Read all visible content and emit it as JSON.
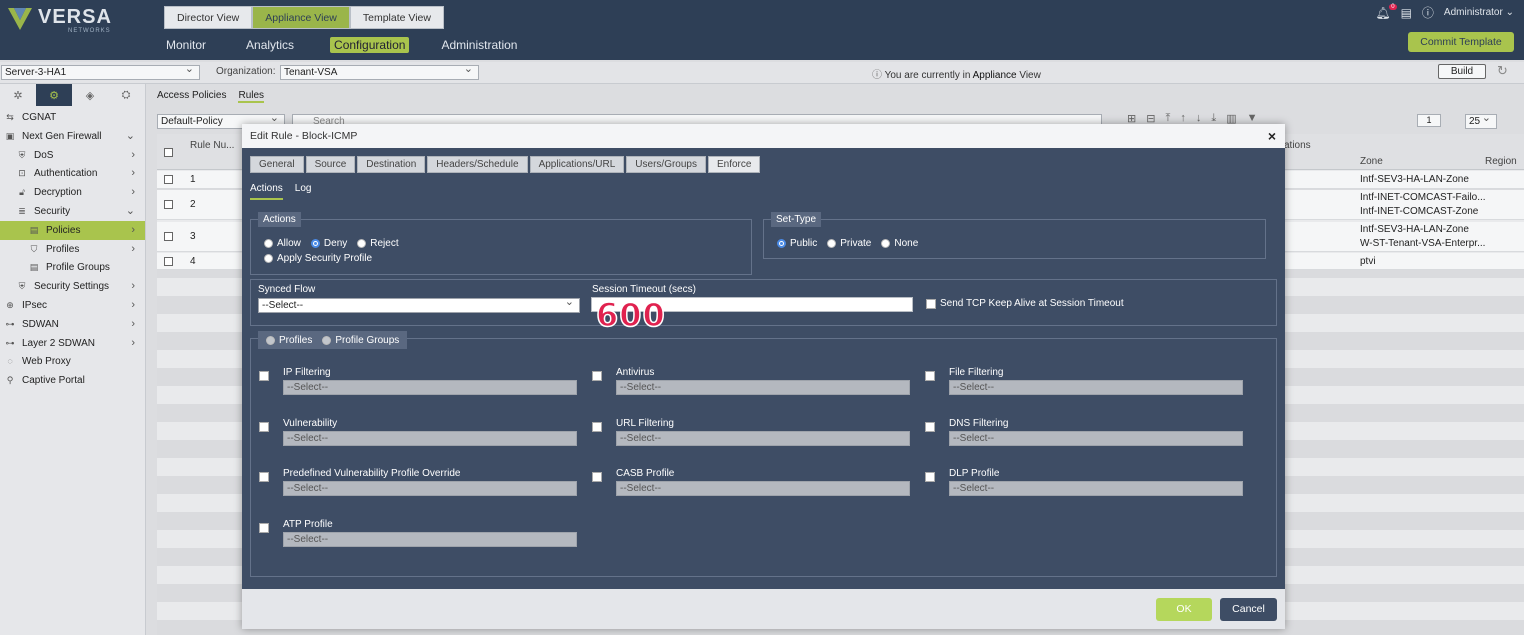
{
  "header": {
    "logo_text": "VERSA",
    "logo_sub": "NETWORKS",
    "view_tabs": [
      {
        "label": "Director View",
        "active": false
      },
      {
        "label": "Appliance View",
        "active": true
      },
      {
        "label": "Template View",
        "active": false
      }
    ],
    "nav": [
      {
        "label": "Monitor",
        "active": false
      },
      {
        "label": "Analytics",
        "active": false
      },
      {
        "label": "Configuration",
        "active": true
      },
      {
        "label": "Administration",
        "active": false
      }
    ],
    "notification_count": "0",
    "user": "Administrator",
    "commit_label": "Commit Template"
  },
  "subbar": {
    "appliance": "Server-3-HA1",
    "org_label": "Organization:",
    "org_value": "Tenant-VSA",
    "info_prefix": "You are currently in ",
    "info_strong": "Appliance",
    "info_suffix": " View",
    "build_label": "Build"
  },
  "sidebar": {
    "items": [
      {
        "label": "CGNAT",
        "icon": "cgnat-icon",
        "indent": 0,
        "chevron": ""
      },
      {
        "label": "Next Gen Firewall",
        "icon": "firewall-icon",
        "indent": 0,
        "chevron": "⌄"
      },
      {
        "label": "DoS",
        "icon": "dos-icon",
        "indent": 1,
        "chevron": "›"
      },
      {
        "label": "Authentication",
        "icon": "authentication-icon",
        "indent": 1,
        "chevron": "›"
      },
      {
        "label": "Decryption",
        "icon": "decryption-icon",
        "indent": 1,
        "chevron": "›"
      },
      {
        "label": "Security",
        "icon": "security-icon",
        "indent": 1,
        "chevron": "⌄"
      },
      {
        "label": "Policies",
        "icon": "policies-icon",
        "indent": 2,
        "chevron": "›",
        "selected": true
      },
      {
        "label": "Profiles",
        "icon": "profiles-icon",
        "indent": 2,
        "chevron": "›"
      },
      {
        "label": "Profile Groups",
        "icon": "profile-groups-icon",
        "indent": 2,
        "chevron": ""
      },
      {
        "label": "Security Settings",
        "icon": "security-settings-icon",
        "indent": 1,
        "chevron": "›"
      },
      {
        "label": "IPsec",
        "icon": "ipsec-icon",
        "indent": 0,
        "chevron": "›"
      },
      {
        "label": "SDWAN",
        "icon": "sdwan-icon",
        "indent": 0,
        "chevron": "›"
      },
      {
        "label": "Layer 2 SDWAN",
        "icon": "layer2-sdwan-icon",
        "indent": 0,
        "chevron": "›"
      },
      {
        "label": "Web Proxy",
        "icon": "web-proxy-icon",
        "indent": 0,
        "chevron": ""
      },
      {
        "label": "Captive Portal",
        "icon": "captive-portal-icon",
        "indent": 0,
        "chevron": ""
      }
    ]
  },
  "content": {
    "breadcrumb": [
      "Access Policies",
      "Rules"
    ],
    "policy": "Default-Policy",
    "search_placeholder": "Search",
    "page": "1",
    "per_page": "25",
    "columns": {
      "rule_num": "Rule Nu...",
      "destinations": "ations",
      "zone": "Zone",
      "region": "Region"
    },
    "rows": [
      {
        "num": "1",
        "zone": [
          "Intf-SEV3-HA-LAN-Zone"
        ]
      },
      {
        "num": "2",
        "zone": [
          "Intf-INET-COMCAST-Failo...",
          "Intf-INET-COMCAST-Zone"
        ]
      },
      {
        "num": "3",
        "zone": [
          "Intf-SEV3-HA-LAN-Zone",
          "W-ST-Tenant-VSA-Enterpr..."
        ]
      },
      {
        "num": "4",
        "zone": [
          "ptvi"
        ]
      }
    ]
  },
  "modal": {
    "title": "Edit Rule - Block-ICMP",
    "tabs": [
      "General",
      "Source",
      "Destination",
      "Headers/Schedule",
      "Applications/URL",
      "Users/Groups",
      "Enforce"
    ],
    "active_tab": "Enforce",
    "subtabs": [
      "Actions",
      "Log"
    ],
    "actions_legend": "Actions",
    "actions": [
      {
        "label": "Allow",
        "checked": false
      },
      {
        "label": "Deny",
        "checked": true
      },
      {
        "label": "Reject",
        "checked": false
      },
      {
        "label": "Apply Security Profile",
        "checked": false
      }
    ],
    "settype_legend": "Set-Type",
    "settypes": [
      {
        "label": "Public",
        "checked": true
      },
      {
        "label": "Private",
        "checked": false
      },
      {
        "label": "None",
        "checked": false
      }
    ],
    "synced_flow_label": "Synced Flow",
    "synced_flow_value": "--Select--",
    "session_timeout_label": "Session Timeout (secs)",
    "session_timeout_value": "",
    "keepalive_label": "Send TCP Keep Alive at Session Timeout",
    "annotation": "600",
    "profile_toggle": [
      "Profiles",
      "Profile Groups"
    ],
    "profiles": [
      {
        "label": "IP Filtering",
        "value": "--Select--"
      },
      {
        "label": "Antivirus",
        "value": "--Select--"
      },
      {
        "label": "File Filtering",
        "value": "--Select--"
      },
      {
        "label": "Vulnerability",
        "value": "--Select--"
      },
      {
        "label": "URL Filtering",
        "value": "--Select--"
      },
      {
        "label": "DNS Filtering",
        "value": "--Select--"
      },
      {
        "label": "Predefined Vulnerability Profile Override",
        "value": "--Select--"
      },
      {
        "label": "CASB Profile",
        "value": "--Select--"
      },
      {
        "label": "DLP Profile",
        "value": "--Select--"
      },
      {
        "label": "ATP Profile",
        "value": "--Select--"
      }
    ],
    "ok_label": "OK",
    "cancel_label": "Cancel"
  }
}
